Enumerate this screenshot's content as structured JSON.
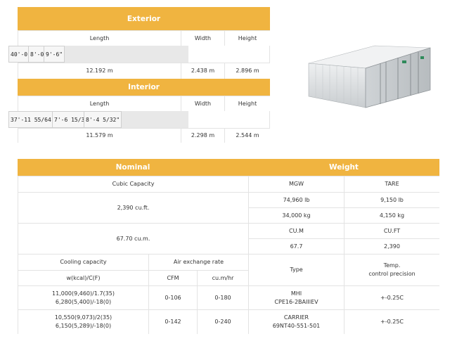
{
  "exterior": {
    "title": "Exterior",
    "headers": [
      "Length",
      "Width",
      "Height"
    ],
    "imperial": [
      "40'-0\"",
      "8'-0\"",
      "9'-6\""
    ],
    "metric": [
      "12.192 m",
      "2.438 m",
      "2.896 m"
    ]
  },
  "interior": {
    "title": "Interior",
    "headers": [
      "Length",
      "Width",
      "Height"
    ],
    "imperial": [
      "37'-11 55/64\"",
      "7'-6 15/32\"",
      "8'-4 5/32\""
    ],
    "metric": [
      "11.579 m",
      "2.298 m",
      "2.544 m"
    ]
  },
  "nominal": {
    "title": "Nominal",
    "cubic_label": "Cubic Capacity",
    "cubic_ft": "2,390 cu.ft.",
    "cubic_m": "67.70 cu.m.",
    "cooling_label": "Cooling capacity",
    "cooling_unit": "w(kcal)/C(F)",
    "air_label": "Air exchange rate",
    "cfm_label": "CFM",
    "cum_label": "cu.m/hr",
    "rows": [
      {
        "cool1": "11,000(9,460)/1.7(35)",
        "cool2": "6,280(5,400)/-18(0)",
        "cfm": "0-106",
        "cum": "0-180"
      },
      {
        "cool1": "10,550(9,073)/2(35)",
        "cool2": "6,150(5,289)/-18(0)",
        "cfm": "0-142",
        "cum": "0-240"
      }
    ]
  },
  "weight": {
    "title": "Weight",
    "mgw_label": "MGW",
    "tare_label": "TARE",
    "mgw_lb": "74,960 lb",
    "tare_lb": "9,150 lb",
    "mgw_kg": "34,000 kg",
    "tare_kg": "4,150 kg",
    "cum_label": "CU.M",
    "cuft_label": "CU.FT",
    "cum_val": "67.7",
    "cuft_val": "2,390",
    "type_label": "Type",
    "temp_label1": "Temp.",
    "temp_label2": "control precision",
    "rows": [
      {
        "type1": "MHI",
        "type2": "CPE16-2BAIIIEV",
        "temp": "+-0.25C"
      },
      {
        "type1": "CARRIER",
        "type2": "69NT40-551-501",
        "temp": "+-0.25C"
      }
    ]
  }
}
